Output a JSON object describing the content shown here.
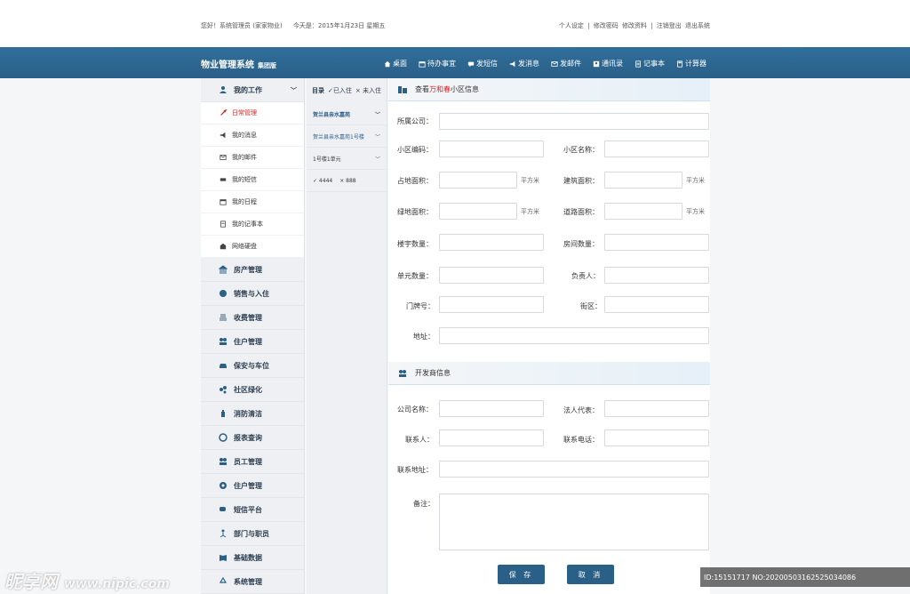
{
  "top": {
    "greeting": "您好！系统管理员 (家家物业)",
    "date": "今天是：2015年1月23日 星期五",
    "links": [
      "个人设定",
      "|",
      "修改密码",
      "修改资料",
      "|",
      "注销登出",
      "退出系统"
    ]
  },
  "header": {
    "brand": "物业管理系统",
    "brand_sub": "集团版",
    "nav": [
      {
        "label": "桌面",
        "icon": "home-icon"
      },
      {
        "label": "待办事宜",
        "icon": "calendar-icon"
      },
      {
        "label": "发短信",
        "icon": "message-icon"
      },
      {
        "label": "发消息",
        "icon": "megaphone-icon"
      },
      {
        "label": "发邮件",
        "icon": "mail-icon"
      },
      {
        "label": "通讯录",
        "icon": "contacts-icon"
      },
      {
        "label": "记事本",
        "icon": "notebook-icon"
      },
      {
        "label": "计算器",
        "icon": "calculator-icon"
      }
    ]
  },
  "sidebar": {
    "expanded": {
      "label": "我的工作",
      "icon": "person-icon"
    },
    "sub_items": [
      {
        "label": "日常管理",
        "icon": "wrench-icon",
        "active": true
      },
      {
        "label": "我的消息",
        "icon": "megaphone-icon"
      },
      {
        "label": "我的邮件",
        "icon": "mail-icon"
      },
      {
        "label": "我的短信",
        "icon": "sms-icon"
      },
      {
        "label": "我的日程",
        "icon": "calendar-icon"
      },
      {
        "label": "我的记事本",
        "icon": "notebook-icon"
      },
      {
        "label": "网络硬盘",
        "icon": "disk-icon"
      }
    ],
    "groups": [
      {
        "label": "房产管理",
        "icon": "building-icon"
      },
      {
        "label": "销售与入住",
        "icon": "handshake-icon"
      },
      {
        "label": "收费管理",
        "icon": "coins-icon"
      },
      {
        "label": "住户管理",
        "icon": "residents-icon"
      },
      {
        "label": "保安与车位",
        "icon": "car-icon"
      },
      {
        "label": "社区绿化",
        "icon": "tree-icon"
      },
      {
        "label": "消防清洁",
        "icon": "extinguisher-icon"
      },
      {
        "label": "报表查询",
        "icon": "report-icon"
      },
      {
        "label": "员工管理",
        "icon": "staff-icon"
      },
      {
        "label": "住户管理",
        "icon": "house-icon"
      },
      {
        "label": "短信平台",
        "icon": "chat-icon"
      },
      {
        "label": "部门与职员",
        "icon": "org-icon"
      },
      {
        "label": "基础数据",
        "icon": "book-icon"
      },
      {
        "label": "系统管理",
        "icon": "recycle-icon"
      }
    ]
  },
  "tree": {
    "title": "目录",
    "checked_in": "✓已入住",
    "not_in": "× 未入住",
    "rows": [
      "贺兰县亲水嘉苑",
      "贺兰县亲水嘉苑1号楼",
      "1号楼1单元"
    ],
    "opt_check": "✓ 4444",
    "opt_cross": "× 888"
  },
  "form": {
    "section1_prefix": "查看",
    "section1_highlight": "万和春",
    "section1_suffix": "小区信息",
    "section2": "开发商信息",
    "labels": {
      "company": "所属公司：",
      "code": "小区编码：",
      "name": "小区名称：",
      "land_area": "占地面积：",
      "build_area": "建筑面积：",
      "green_area": "绿地面积：",
      "road_area": "道路面积：",
      "buildings": "楼宇数量：",
      "rooms": "房间数量：",
      "units": "单元数量：",
      "manager": "负责人：",
      "door_no": "门牌号：",
      "street": "街区：",
      "address": "地址：",
      "dev_name": "公司名称：",
      "legal_rep": "法人代表：",
      "contact": "联系人：",
      "phone": "联系电话：",
      "contact_addr": "联系地址：",
      "remark": "备注："
    },
    "unit": "平方米",
    "save": "保 存",
    "cancel": "取 消"
  },
  "watermark": {
    "brand": "昵享网",
    "url": "www.nipic.com",
    "id": "ID:15151717 NO:20200503162525034086"
  }
}
